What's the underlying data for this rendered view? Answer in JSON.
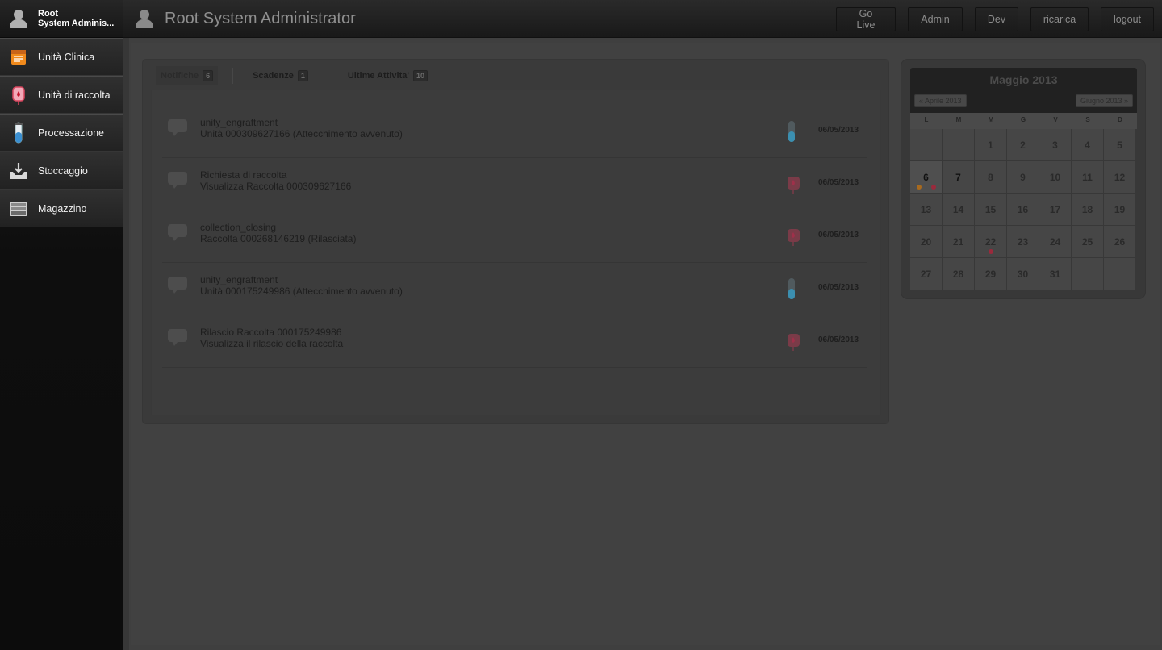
{
  "sidebar": {
    "user": {
      "name": "Root",
      "role": "System Adminis..."
    },
    "items": [
      {
        "label": "Unità Clinica",
        "icon": "notepad-icon"
      },
      {
        "label": "Unità di raccolta",
        "icon": "blood-bag-icon"
      },
      {
        "label": "Processazione",
        "icon": "test-tube-icon"
      },
      {
        "label": "Stoccaggio",
        "icon": "inbox-download-icon"
      },
      {
        "label": "Magazzino",
        "icon": "drawer-icon"
      }
    ]
  },
  "header": {
    "title": "Root System Administrator",
    "buttons": [
      "Go Live",
      "Admin",
      "Dev",
      "ricarica",
      "logout"
    ]
  },
  "tabs": [
    {
      "label": "Notifiche",
      "count": "6"
    },
    {
      "label": "Scadenze",
      "count": "1"
    },
    {
      "label": "Ultime Attivita'",
      "count": "10"
    }
  ],
  "notifications": [
    {
      "title": "unity_engraftment",
      "subtitle": "Unità 000309627166 (Attecchimento avvenuto)",
      "date": "06/05/2013",
      "icon": "test-tube-icon"
    },
    {
      "title": "Richiesta di raccolta",
      "subtitle": "Visualizza Raccolta 000309627166",
      "date": "06/05/2013",
      "icon": "blood-bag-icon"
    },
    {
      "title": "collection_closing",
      "subtitle": "Raccolta 000268146219 (Rilasciata)",
      "date": "06/05/2013",
      "icon": "blood-bag-icon"
    },
    {
      "title": "unity_engraftment",
      "subtitle": "Unità 000175249986 (Attecchimento avvenuto)",
      "date": "06/05/2013",
      "icon": "test-tube-icon"
    },
    {
      "title": "Rilascio Raccolta 000175249986",
      "subtitle": "Visualizza il rilascio della raccolta",
      "date": "06/05/2013",
      "icon": "blood-bag-icon"
    }
  ],
  "calendar": {
    "title": "Maggio 2013",
    "prev": "« Aprile 2013",
    "next": "Giugno 2013 »",
    "weekdays": [
      "L",
      "M",
      "M",
      "G",
      "V",
      "S",
      "D"
    ],
    "days": [
      "",
      "",
      "1",
      "2",
      "3",
      "4",
      "5",
      "6",
      "7",
      "8",
      "9",
      "10",
      "11",
      "12",
      "13",
      "14",
      "15",
      "16",
      "17",
      "18",
      "19",
      "20",
      "21",
      "22",
      "23",
      "24",
      "25",
      "26",
      "27",
      "28",
      "29",
      "30",
      "31",
      "",
      ""
    ],
    "today": "6",
    "emphasized": [
      "6",
      "7"
    ],
    "events": {
      "6": [
        "#a86a1e",
        "#9a2a3c"
      ],
      "22": [
        "#9a2a3c"
      ]
    }
  },
  "colors": {
    "tube": "#3b8fb0",
    "bag": "#a0304a"
  }
}
